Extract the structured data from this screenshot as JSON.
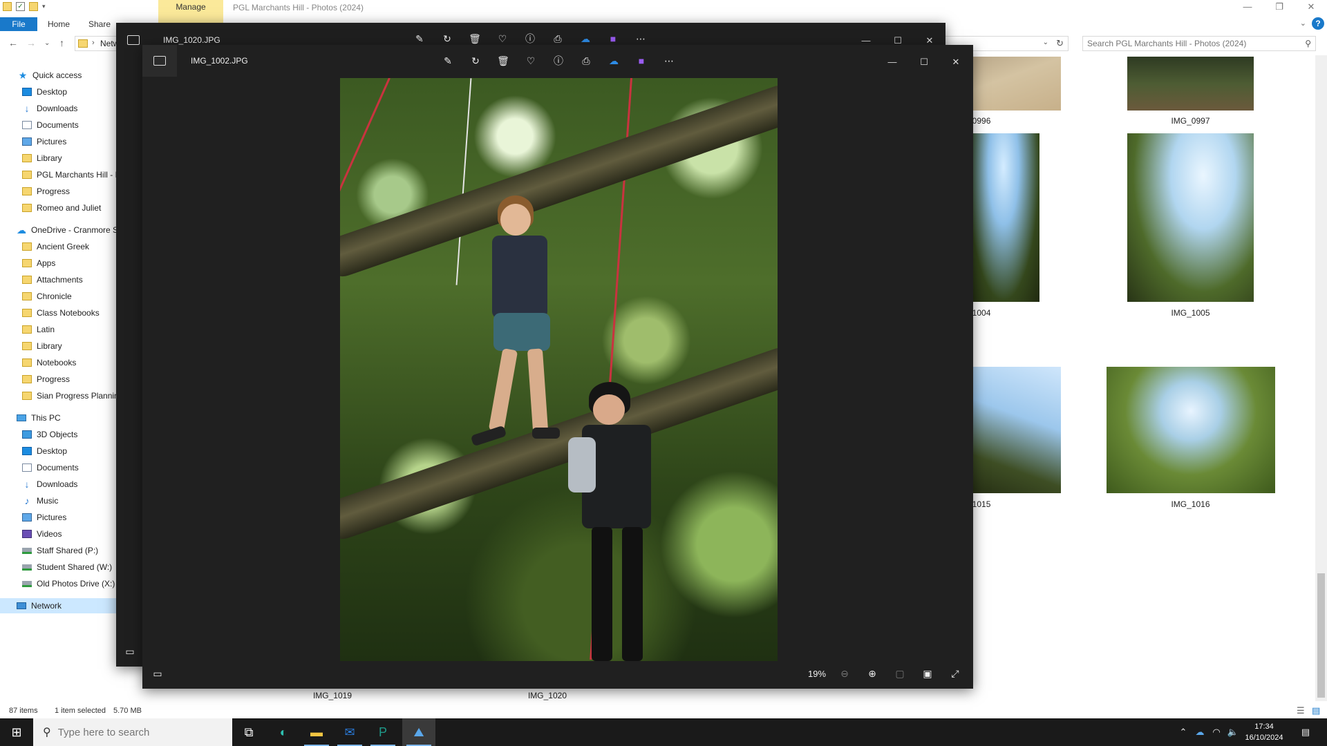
{
  "explorer": {
    "manage_tab": "Manage",
    "window_title": "PGL Marchants Hill - Photos (2024)",
    "ribbon": {
      "file": "File",
      "home": "Home",
      "share": "Share"
    },
    "address_crumb": "Netw",
    "search_placeholder": "Search PGL Marchants Hill - Photos (2024)",
    "nav": {
      "quick_access": "Quick access",
      "quick_items": [
        "Desktop",
        "Downloads",
        "Documents",
        "Pictures",
        "Library",
        "PGL Marchants Hill - P",
        "Progress",
        "Romeo and Juliet"
      ],
      "onedrive": "OneDrive - Cranmore S",
      "onedrive_items": [
        "Ancient Greek",
        "Apps",
        "Attachments",
        "Chronicle",
        "Class Notebooks",
        "Latin",
        "Library",
        "Notebooks",
        "Progress",
        "Sian Progress Plannin"
      ],
      "this_pc": "This PC",
      "pc_items": [
        "3D Objects",
        "Desktop",
        "Documents",
        "Downloads",
        "Music",
        "Pictures",
        "Videos",
        "Staff Shared (P:)",
        "Student Shared (W:)",
        "Old Photos Drive (X:)"
      ],
      "network": "Network"
    },
    "thumbnails": {
      "img_0996": "_0996",
      "img_0997": "IMG_0997",
      "img_1004": "_1004",
      "img_1005": "IMG_1005",
      "img_1015": "_1015",
      "img_1016": "IMG_1016",
      "img_1019": "IMG_1019",
      "img_1020": "IMG_1020"
    },
    "status": {
      "items": "87 items",
      "selected": "1 item selected",
      "size": "5.70 MB"
    }
  },
  "photos_back": {
    "title": "IMG_1020.JPG"
  },
  "photos_front": {
    "title": "IMG_1002.JPG",
    "zoom": "19%"
  },
  "taskbar": {
    "search_placeholder": "Type here to search",
    "time": "17:34",
    "date": "16/10/2024"
  }
}
